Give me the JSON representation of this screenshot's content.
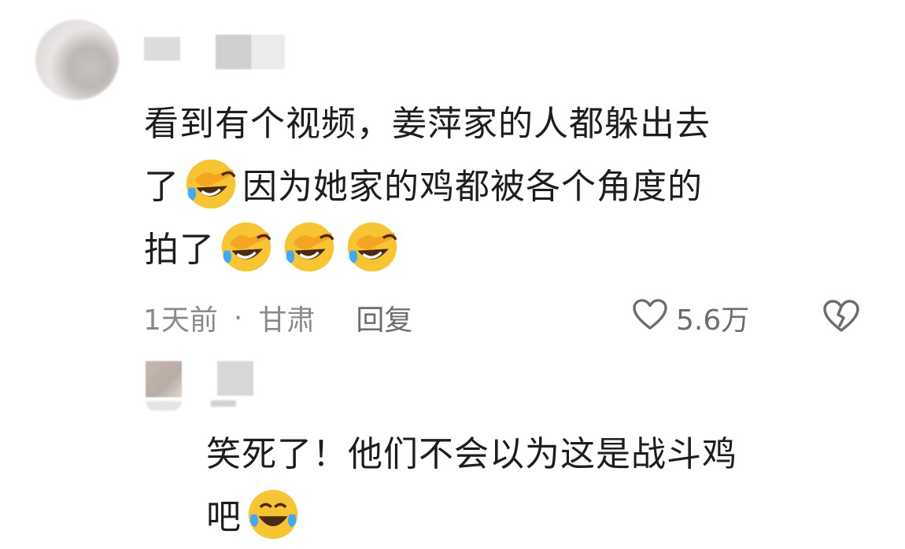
{
  "comment": {
    "text_line1": "看到有个视频，姜萍家的人都躲出去",
    "text_line2_start": "了",
    "text_line2_rest": "因为她家的鸡都被各个角度的",
    "text_line3": "拍了",
    "emoji_name": "laugh-crying-face-icon",
    "meta": {
      "time": "1天前",
      "dot": "·",
      "location": "甘肃",
      "reply_label": "回复",
      "likes": "5.6万"
    }
  },
  "reply": {
    "text_line1": "笑死了！他们不会以为这是战斗鸡",
    "text_line2": "吧"
  },
  "colors": {
    "text": "#1d1d1d",
    "meta": "#8a8a8a",
    "emoji_yellow": "#f7c533",
    "emoji_tear": "#3fa9f5"
  }
}
